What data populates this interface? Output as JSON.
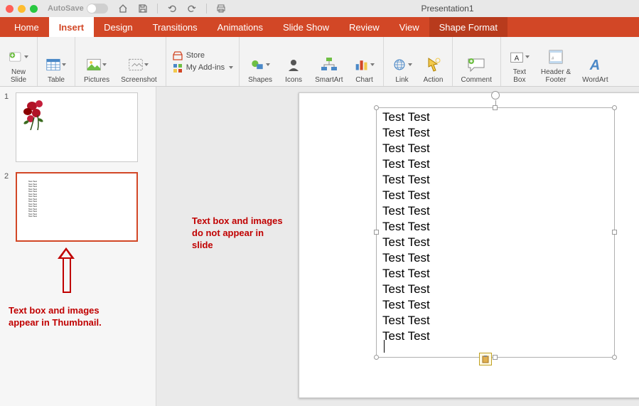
{
  "titlebar": {
    "autosave_label": "AutoSave",
    "autosave_state": "OFF",
    "doc_title": "Presentation1"
  },
  "tabs": {
    "home": "Home",
    "insert": "Insert",
    "design": "Design",
    "transitions": "Transitions",
    "animations": "Animations",
    "slideshow": "Slide Show",
    "review": "Review",
    "view": "View",
    "shapeformat": "Shape Format"
  },
  "ribbon": {
    "new_slide": "New\nSlide",
    "table": "Table",
    "pictures": "Pictures",
    "screenshot": "Screenshot",
    "store": "Store",
    "addins": "My Add-ins",
    "shapes": "Shapes",
    "icons": "Icons",
    "smartart": "SmartArt",
    "chart": "Chart",
    "link": "Link",
    "action": "Action",
    "comment": "Comment",
    "textbox": "Text\nBox",
    "headerfooter": "Header &\nFooter",
    "wordart": "WordArt"
  },
  "thumbs": {
    "n1": "1",
    "n2": "2"
  },
  "slide_text": {
    "l1": "Test Test",
    "l2": "Test Test",
    "l3": "Test Test",
    "l4": "Test Test",
    "l5": "Test Test",
    "l6": "Test Test",
    "l7": "Test Test",
    "l8": "Test Test",
    "l9": "Test Test",
    "l10": "Test Test",
    "l11": "Test Test",
    "l12": "Test Test",
    "l13": "Test Test",
    "l14": "Test Test",
    "l15": "Test Test"
  },
  "annotations": {
    "thumb_note": "Text box and images\nappear in Thumbnail.",
    "slide_note": "Text box and images\ndo not appear in\nslide"
  }
}
